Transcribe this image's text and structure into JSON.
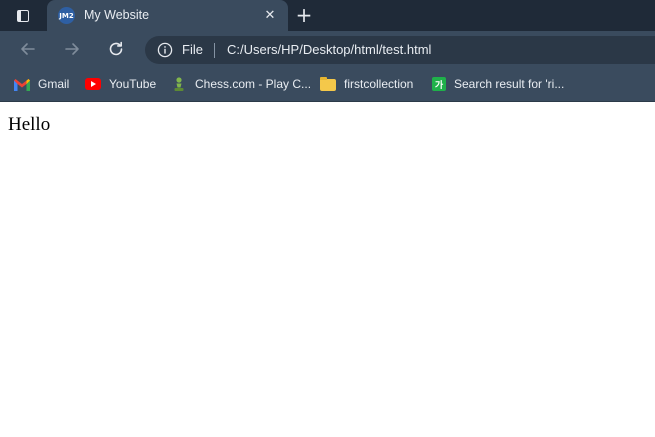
{
  "tab": {
    "title": "My Website",
    "favicon_text": "JM2",
    "close_symbol": "✕",
    "new_tab_symbol": "+"
  },
  "toolbar": {
    "site_chip": "File",
    "url": "C:/Users/HP/Desktop/html/test.html"
  },
  "bookmarks": [
    {
      "label": "Gmail",
      "icon": "gmail-icon"
    },
    {
      "label": "YouTube",
      "icon": "youtube-icon"
    },
    {
      "label": "Chess.com - Play C...",
      "icon": "chess-pawn-icon"
    },
    {
      "label": "firstcollection",
      "icon": "folder-icon"
    },
    {
      "label": "Search result for 'ri...",
      "icon": "naver-dictionary-icon",
      "icon_text": "가"
    }
  ],
  "page": {
    "heading": "Hello"
  },
  "colors": {
    "tabstrip": "#1f2a38",
    "toolbar": "#3a4b5e",
    "omnibox": "#2b3847",
    "text": "#e9edf2"
  }
}
